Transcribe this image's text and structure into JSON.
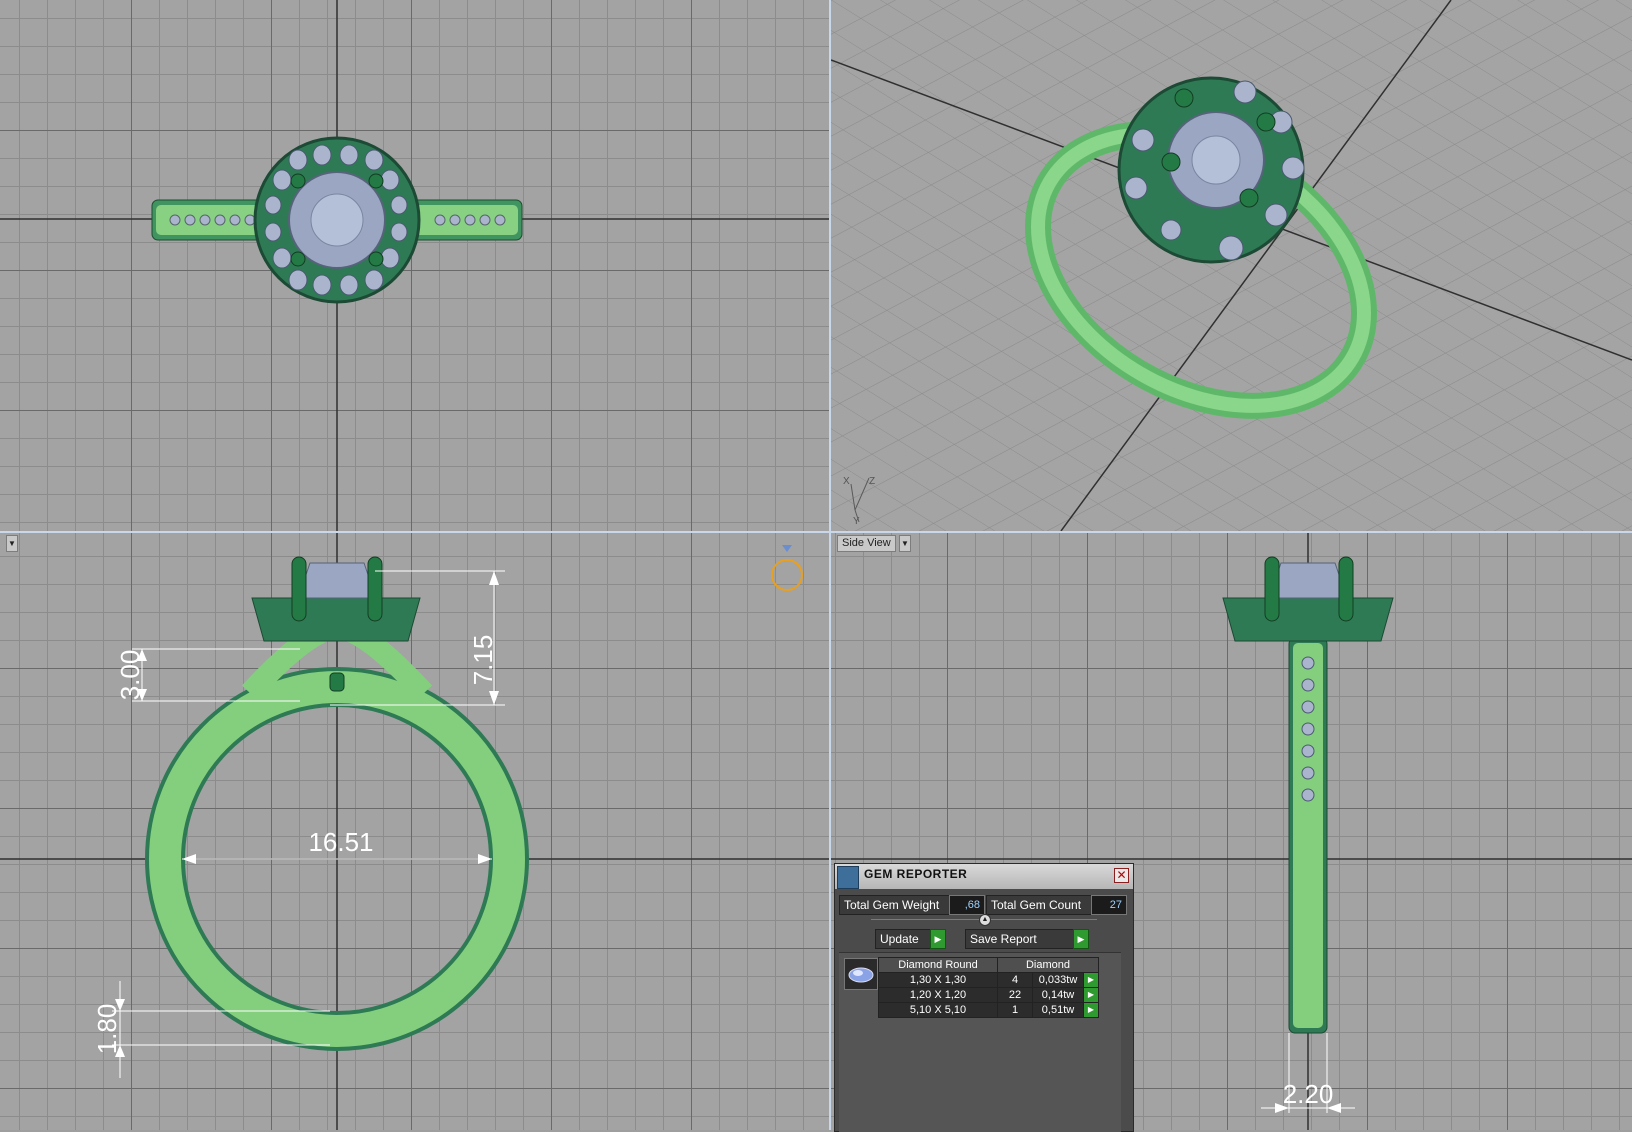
{
  "viewports": {
    "front": {
      "menu_label": ""
    },
    "side": {
      "view_label": "Side View"
    }
  },
  "dimensions": {
    "front_height": "7.15",
    "front_shoulder": "3.00",
    "front_inner_diameter": "16.51",
    "front_band_thickness": "1.80",
    "side_band_width": "2.20"
  },
  "axis": {
    "x": "X",
    "y": "Y",
    "z": "Z"
  },
  "gem_reporter": {
    "title": "GEM REPORTER",
    "total_weight_label": "Total Gem Weight",
    "total_weight_value": ",68",
    "total_count_label": "Total Gem Count",
    "total_count_value": "27",
    "update_label": "Update",
    "save_report_label": "Save Report",
    "table_headers": [
      "Diamond Round",
      "Diamond"
    ],
    "rows": [
      {
        "size": "1,30 X 1,30",
        "count": "4",
        "weight": "0,033tw"
      },
      {
        "size": "1,20 X 1,20",
        "count": "22",
        "weight": "0,14tw"
      },
      {
        "size": "5,10 X 5,10",
        "count": "1",
        "weight": "0,51tw"
      }
    ]
  },
  "colors": {
    "metal_light": "#7fcf7f",
    "metal_dark": "#2e7a55",
    "gem": "#aab4cc",
    "grid_bg": "#a3a3a3",
    "accent_orange": "#e8a020"
  }
}
